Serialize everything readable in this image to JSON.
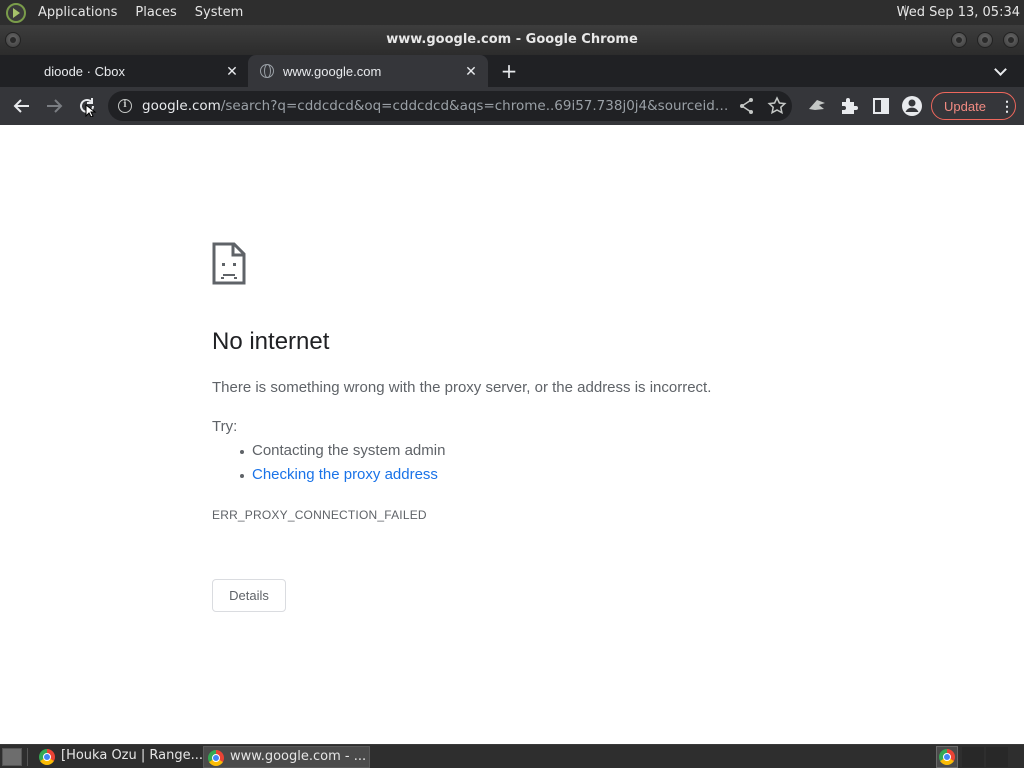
{
  "top_panel": {
    "menus": [
      "Applications",
      "Places",
      "System"
    ],
    "clock": "Wed Sep 13, 05:34"
  },
  "window": {
    "title": "www.google.com - Google Chrome"
  },
  "tabs": [
    {
      "label": "dioode · Cbox",
      "active": false
    },
    {
      "label": "www.google.com",
      "active": true
    }
  ],
  "toolbar": {
    "url_host": "google.com",
    "url_path": "/search?q=cddcdcd&oq=cddcdcd&aqs=chrome..69i57.738j0j4&sourceid=chrom...",
    "update_label": "Update"
  },
  "error_page": {
    "title": "No internet",
    "description": "There is something wrong with the proxy server, or the address is incorrect.",
    "try_label": "Try:",
    "suggestions": [
      {
        "text": "Contacting the system admin",
        "link": false
      },
      {
        "text": "Checking the proxy address",
        "link": true
      }
    ],
    "error_code": "ERR_PROXY_CONNECTION_FAILED",
    "details_label": "Details"
  },
  "taskbar": {
    "tasks": [
      {
        "label": "[Houka Ozu | Range...",
        "active": false
      },
      {
        "label": "www.google.com - ...",
        "active": true
      }
    ]
  },
  "colors": {
    "link": "#1a73e8",
    "title_text": "#202124",
    "body_text": "#5f6368",
    "toolbar_bg": "#35363a",
    "tabstrip_bg": "#202124",
    "update_accent": "#ee675c"
  },
  "icons": {
    "error_icon": "sad-page-icon",
    "reload": "reload-icon",
    "back": "back-arrow-icon",
    "forward": "forward-arrow-icon"
  }
}
